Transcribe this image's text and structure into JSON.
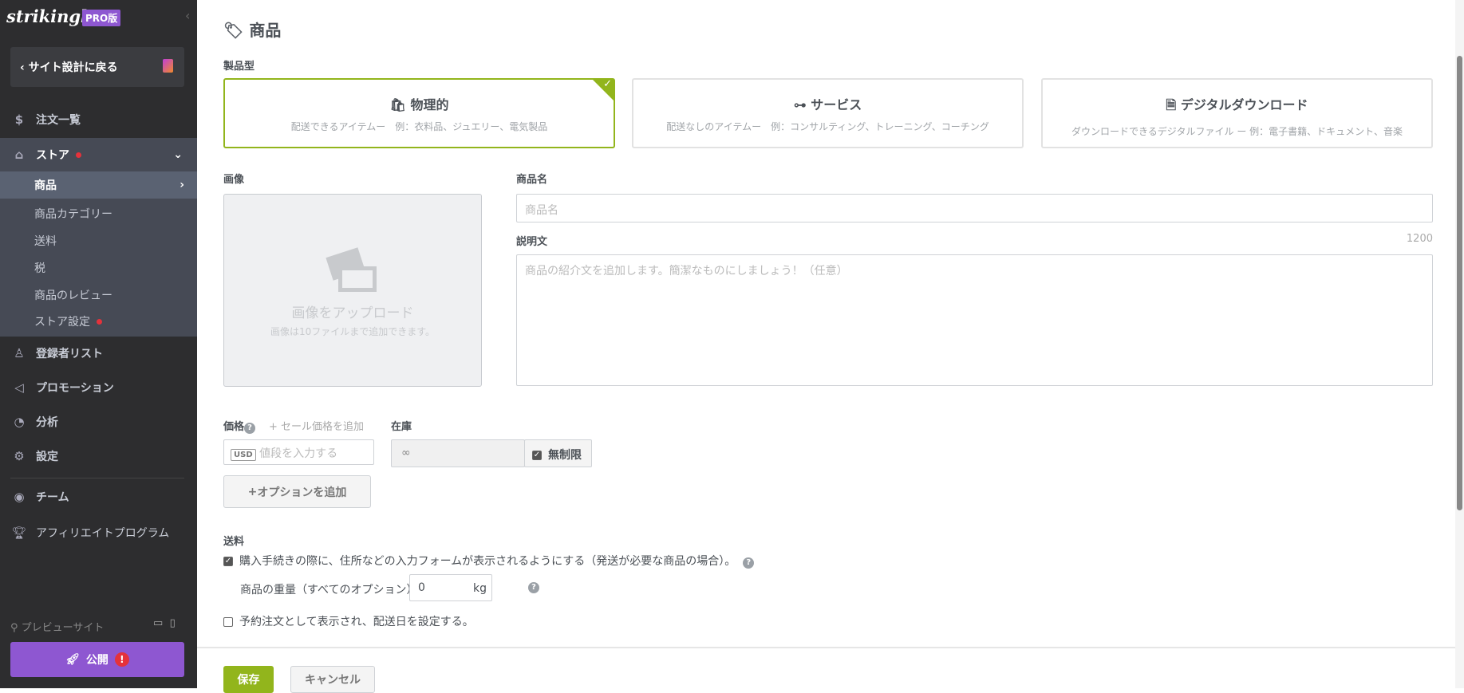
{
  "sidebar": {
    "logo": "strikingly",
    "pro_badge": "PRO版",
    "back_label": "サイト設計に戻る",
    "orders": "注文一覧",
    "store": "ストア",
    "store_items": [
      "商品",
      "商品カテゴリー",
      "送料",
      "税",
      "商品のレビュー",
      "ストア設定"
    ],
    "subscribers": "登録者リスト",
    "promotion": "プロモーション",
    "analytics": "分析",
    "settings": "設定",
    "team": "チーム",
    "affiliate": "アフィリエイトプログラム",
    "preview": "プレビューサイト",
    "publish": "公開"
  },
  "page": {
    "title": "商品",
    "product_type_label": "製品型",
    "types": [
      {
        "title": "物理的",
        "desc": "配送できるアイテムー　例：衣料品、ジュエリー、電気製品",
        "selected": true
      },
      {
        "title": "サービス",
        "desc": "配送なしのアイテムー　例：コンサルティング、トレーニング、コーチング",
        "selected": false
      },
      {
        "title": "デジタルダウンロード",
        "desc": "ダウンロードできるデジタルファイル ー 例：電子書籍、ドキュメント、音楽",
        "selected": false
      }
    ],
    "image_label": "画像",
    "upload_title": "画像をアップロード",
    "upload_hint": "画像は10ファイルまで追加できます。",
    "name_label": "商品名",
    "name_placeholder": "商品名",
    "desc_label": "説明文",
    "desc_limit": "1200",
    "desc_placeholder": "商品の紹介文を追加します。簡潔なものにしましょう！（任意）",
    "price_label": "価格",
    "sale_link": "+ セール価格を追加",
    "currency": "USD",
    "price_placeholder": "値段を入力する",
    "stock_label": "在庫",
    "stock_value": "∞",
    "unlimited": "無制限",
    "add_option": "オプションを追加",
    "shipping_label": "送料",
    "shipping_check": "購入手続きの際に、住所などの入力フォームが表示されるようにする（発送が必要な商品の場合）。",
    "weight_label": "商品の重量（すべてのオプション）",
    "weight_value": "0",
    "weight_unit": "kg",
    "preorder": "予約注文として表示され、配送日を設定する。",
    "save": "保存",
    "cancel": "キャンセル"
  },
  "colors": {
    "accent": "#92b51c",
    "purple": "#8e57d1",
    "sidebar": "#2d2d2f"
  }
}
